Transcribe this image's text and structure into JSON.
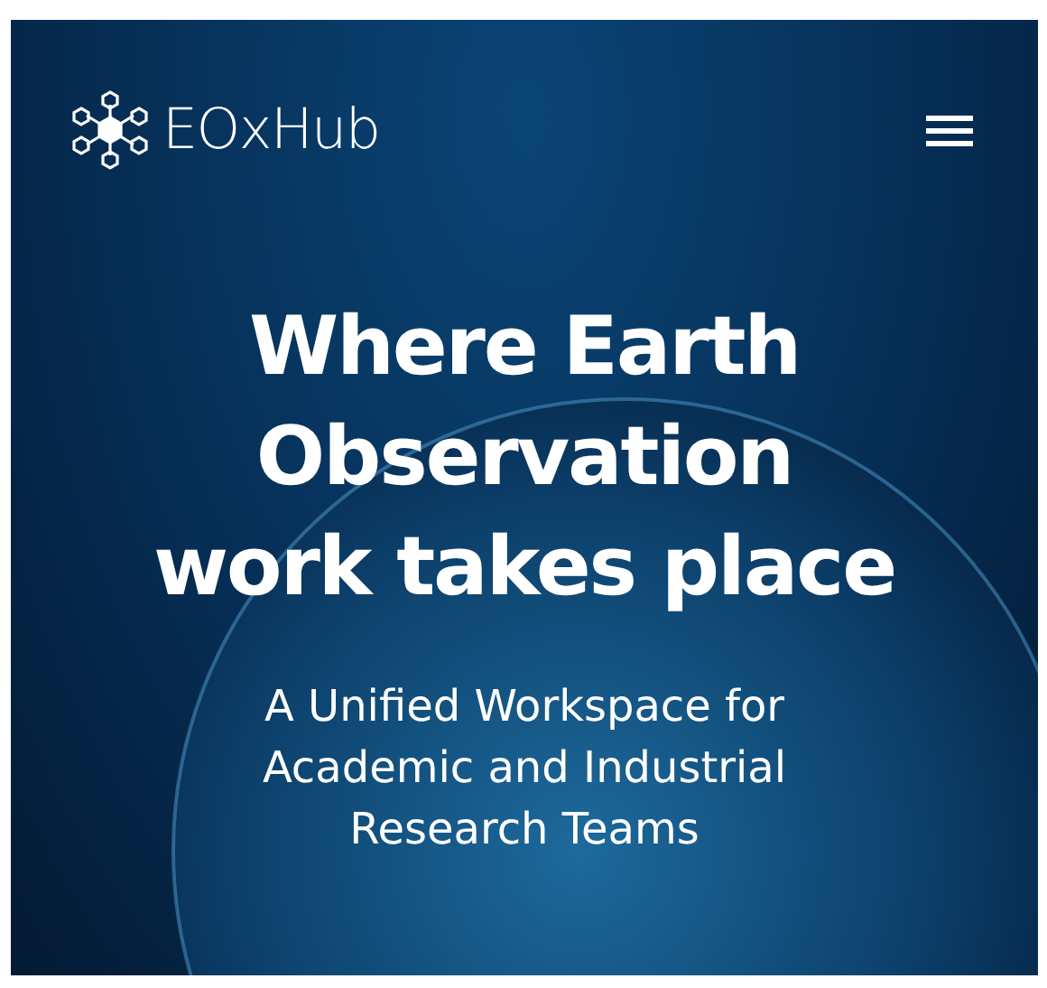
{
  "header": {
    "logo_text": "EOxHub"
  },
  "hero": {
    "headline": [
      "Where Earth",
      "Observation",
      "work takes place"
    ],
    "subtitle": [
      "A Unified Workspace for",
      "Academic and Industrial",
      "Research Teams"
    ]
  }
}
